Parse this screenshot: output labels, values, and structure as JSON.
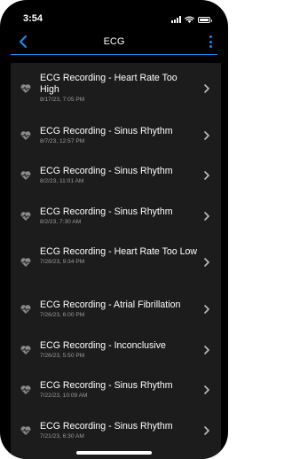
{
  "status_bar": {
    "time": "3:54",
    "icons": [
      "signal-icon",
      "wifi-icon",
      "battery-icon"
    ]
  },
  "nav": {
    "title": "ECG",
    "back_icon": "chevron-left-icon",
    "menu_icon": "more-vertical-icon"
  },
  "colors": {
    "accent": "#1e88e5",
    "background": "#000000",
    "list_background": "#1c1c1c",
    "secondary_text": "#9a9a9a",
    "icon_gray": "#8a8a8a"
  },
  "recordings": [
    {
      "title": "ECG Recording - Heart Rate Too High",
      "date": "8/17/23, 7:05 PM"
    },
    {
      "title": "ECG Recording - Sinus Rhythm",
      "date": "8/7/23, 12:57 PM"
    },
    {
      "title": "ECG Recording - Sinus Rhythm",
      "date": "8/2/23, 11:01 AM"
    },
    {
      "title": "ECG Recording - Sinus Rhythm",
      "date": "8/2/23, 7:30 AM"
    },
    {
      "title": "ECG Recording - Heart Rate Too Low",
      "date": "7/28/23, 9:34 PM"
    },
    {
      "title": "ECG Recording - Atrial Fibrillation",
      "date": "7/26/23, 6:00 PM"
    },
    {
      "title": "ECG Recording - Inconclusive",
      "date": "7/26/23, 5:50 PM"
    },
    {
      "title": "ECG Recording - Sinus Rhythm",
      "date": "7/22/23, 10:09 AM"
    },
    {
      "title": "ECG Recording - Sinus Rhythm",
      "date": "7/21/23, 6:30 AM"
    }
  ]
}
